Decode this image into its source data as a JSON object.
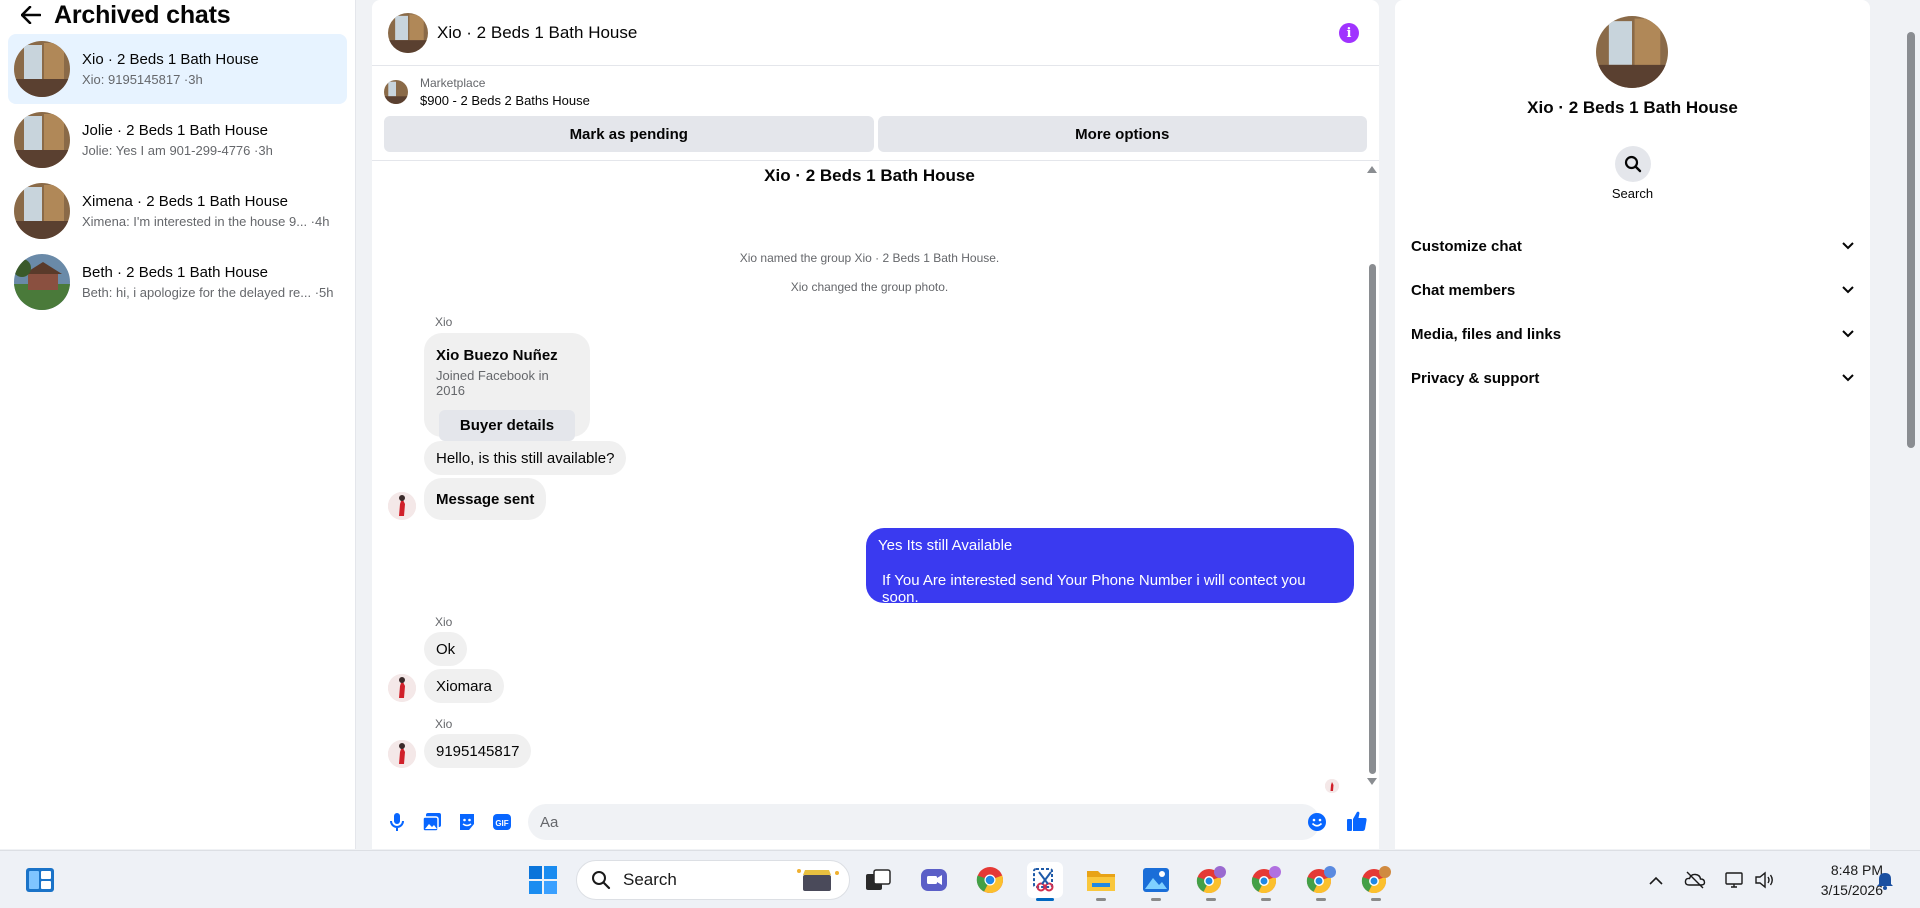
{
  "sidebar": {
    "title": "Archived chats",
    "chats": [
      {
        "name": "Xio · 2 Beds 1 Bath House",
        "preview": "Xio: 9195145817 ·3h"
      },
      {
        "name": "Jolie · 2 Beds 1 Bath House",
        "preview": "Jolie: Yes I am 901-299-4776 ·3h"
      },
      {
        "name": "Ximena · 2 Beds 1 Bath House",
        "preview": "Ximena: I'm interested in the house 9... ·4h"
      },
      {
        "name": "Beth · 2 Beds 1 Bath House",
        "preview": "Beth: hi, i apologize for the delayed re... ·5h"
      }
    ]
  },
  "chat": {
    "header_name": "Xio · 2 Beds 1 Bath House",
    "marketplace_label": "Marketplace",
    "listing": "$900 - 2 Beds 2 Baths House",
    "mark_pending": "Mark as pending",
    "more_options": "More options",
    "conversation_title": "Xio · 2 Beds 1 Bath House",
    "sys_named": "Xio named the group Xio · 2 Beds 1 Bath House.",
    "sys_photo": "Xio changed the group photo.",
    "sender": "Xio",
    "card_name": "Xio Buezo Nuñez",
    "card_sub": "Joined Facebook in 2016",
    "card_button": "Buyer details",
    "msg_available": "Hello, is this still available?",
    "msg_sent": "Message sent",
    "out_line1": "Yes Its still Available",
    "out_line2": "If You Are interested send Your Phone Number i will contect you soon.",
    "msg_ok": "Ok",
    "msg_name": "Xiomara",
    "msg_phone": "9195145817",
    "composer_placeholder": "Aa"
  },
  "details": {
    "name": "Xio · 2 Beds 1 Bath House",
    "search_label": "Search",
    "sections": [
      "Customize chat",
      "Chat members",
      "Media, files and links",
      "Privacy & support"
    ]
  },
  "taskbar": {
    "search_placeholder": "Search",
    "time": "8:48 PM",
    "date": "3/15/2026"
  },
  "colors": {
    "accent": "#0866ff",
    "outgoing_bubble": "#3a3af0",
    "info_button": "#a033ff",
    "active_chat": "#e7f3ff"
  }
}
